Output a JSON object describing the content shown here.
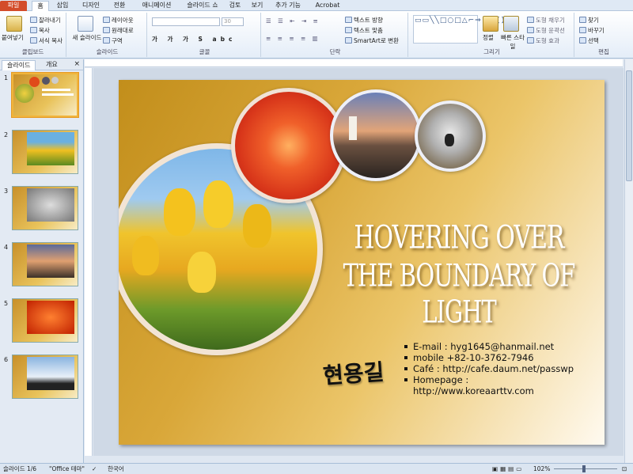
{
  "tabs": [
    "파일",
    "홈",
    "삽입",
    "디자인",
    "전환",
    "애니메이션",
    "슬라이드 쇼",
    "검토",
    "보기",
    "추가 기능",
    "Acrobat"
  ],
  "ribbon": {
    "clipboard": {
      "label": "클립보드",
      "paste": "붙여넣기",
      "cut": "잘라내기",
      "copy": "복사",
      "format_painter": "서식 복사"
    },
    "slides": {
      "label": "슬라이드",
      "new_slide": "새 슬라이드",
      "layout": "레이아웃",
      "reset": "원래대로",
      "section": "구역"
    },
    "font": {
      "label": "글꼴",
      "size": "30"
    },
    "paragraph": {
      "label": "단락",
      "text_direction": "텍스트 방향",
      "align_text": "텍스트 맞춤",
      "smartart": "SmartArt로 변환"
    },
    "drawing": {
      "label": "그리기",
      "arrange": "정렬",
      "quick_styles": "빠른 스타일",
      "shape_fill": "도형 채우기",
      "shape_outline": "도형 윤곽선",
      "shape_effects": "도형 효과"
    },
    "editing": {
      "label": "편집",
      "find": "찾기",
      "replace": "바꾸기",
      "select": "선택"
    }
  },
  "panel": {
    "tab_slides": "슬라이드",
    "tab_outline": "개요",
    "close": "×"
  },
  "thumbs": [
    "1",
    "2",
    "3",
    "4",
    "5",
    "6"
  ],
  "slide": {
    "title_line1": "HOVERING OVER",
    "title_line2": "THE BOUNDARY OF LIGHT",
    "signature": "현용길",
    "contact": [
      "E-mail : hyg1645@hanmail.net",
      "mobile +82-10-3762-7946",
      "Café : http://cafe.daum.net/passwp",
      "Homepage :",
      "http://www.koreaarttv.com"
    ]
  },
  "status": {
    "slide_info": "슬라이드 1/6",
    "theme": "\"Office 테마\"",
    "language": "한국어",
    "zoom": "102%"
  }
}
